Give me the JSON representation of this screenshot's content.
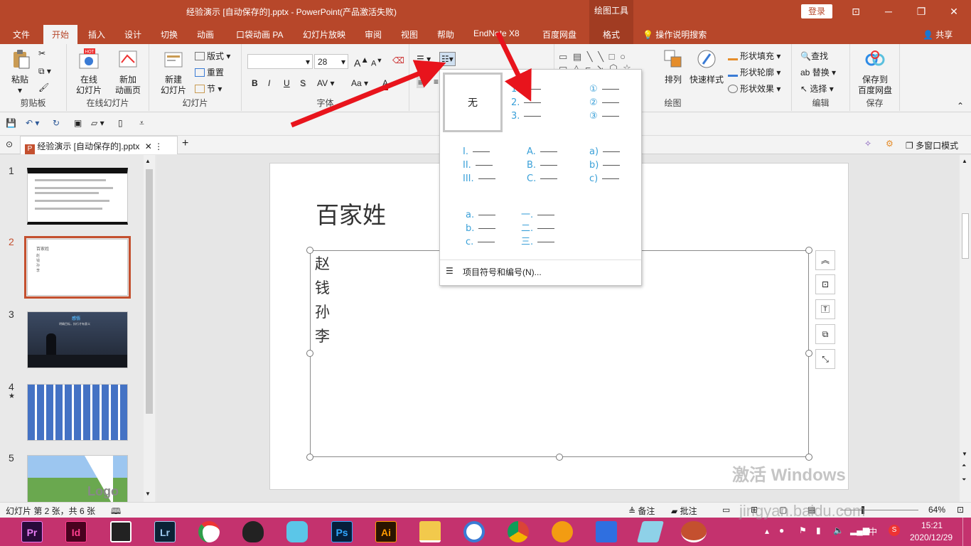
{
  "window": {
    "title": "经验演示 [自动保存的].pptx  -  PowerPoint(产品激活失败)",
    "context_tab": "绘图工具",
    "login": "登录",
    "minimize": "─",
    "restore": "❐",
    "close": "✕",
    "ribbon_display": "⊡"
  },
  "tabs": [
    {
      "label": "文件"
    },
    {
      "label": "开始"
    },
    {
      "label": "插入"
    },
    {
      "label": "设计"
    },
    {
      "label": "切换"
    },
    {
      "label": "动画"
    },
    {
      "label": "口袋动画 PA"
    },
    {
      "label": "幻灯片放映"
    },
    {
      "label": "审阅"
    },
    {
      "label": "视图"
    },
    {
      "label": "帮助"
    },
    {
      "label": "EndNote X8"
    },
    {
      "label": "百度网盘"
    },
    {
      "label": "格式"
    }
  ],
  "tell_me": "操作说明搜索",
  "share": "共享",
  "ribbon": {
    "clipboard": {
      "paste": "粘贴",
      "label": "剪贴板"
    },
    "online": {
      "online_slide": "在线\n幻灯片",
      "new_anim": "新加\n动画页",
      "label": "在线幻灯片",
      "hot": "HOT"
    },
    "slides": {
      "new_slide": "新建\n幻灯片",
      "layout": "版式",
      "reset": "重置",
      "section": "节",
      "label": "幻灯片"
    },
    "font": {
      "font_name": "",
      "font_size": "28",
      "label": "字体",
      "bold": "B",
      "italic": "I",
      "underline": "U",
      "shadow": "S",
      "spacing": "AV",
      "case": "Aa",
      "grow": "A",
      "shrink": "A"
    },
    "drawing": {
      "arrange": "排列",
      "quick_styles": "快速样式",
      "fill": "形状填充",
      "outline": "形状轮廓",
      "effects": "形状效果",
      "label": "绘图"
    },
    "editing": {
      "find": "查找",
      "replace": "替换",
      "select": "选择",
      "label": "编辑"
    },
    "save": {
      "save_baidu": "保存到\n百度网盘",
      "label": "保存"
    }
  },
  "doc_tab": {
    "name": "经验演示  [自动保存的].pptx"
  },
  "multi_window": "多窗口模式",
  "thumbnails": [
    {
      "num": "1"
    },
    {
      "num": "2"
    },
    {
      "num": "3"
    },
    {
      "num": "4",
      "star": "★"
    },
    {
      "num": "5"
    }
  ],
  "thumb_text": {
    "slide2_title": "百家姓",
    "slide2_items": "赵 钱 孙 李",
    "slide3_title": "感悟",
    "slide3_sub": "明确目标，执行才有意义",
    "slide5_logo": "Logo"
  },
  "slide": {
    "title": "百家姓",
    "items": [
      "赵",
      "钱",
      "孙",
      "李"
    ]
  },
  "numbering_menu": {
    "none": "无",
    "options": [
      [
        "1.",
        "2.",
        "3."
      ],
      [
        "①",
        "②",
        "③"
      ],
      [
        "I.",
        "II.",
        "III."
      ],
      [
        "A.",
        "B.",
        "C."
      ],
      [
        "a)",
        "b)",
        "c)"
      ],
      [
        "a.",
        "b.",
        "c."
      ],
      [
        "一.",
        "二.",
        "三."
      ]
    ],
    "footer": "项目符号和编号(N)..."
  },
  "status": {
    "slide_info": "幻灯片 第 2 张，共 6 张",
    "notes": "备注",
    "comments": "批注",
    "zoom": "64%"
  },
  "taskbar": {
    "apps": [
      "Pr",
      "Id",
      "",
      "Lr",
      "",
      "",
      "",
      "Ps",
      "Ai",
      "",
      "",
      "",
      "",
      "",
      "",
      ""
    ],
    "time": "15:21",
    "date": "2020/12/29",
    "ime": "中"
  },
  "watermark": {
    "line1": "激活 Windows",
    "line2": "jingyan.baidu.com"
  },
  "colors": {
    "accent": "#b7472a",
    "taskbar": "#c4326e",
    "numbering": "#3aa0d8",
    "arrow": "#e8141c"
  }
}
